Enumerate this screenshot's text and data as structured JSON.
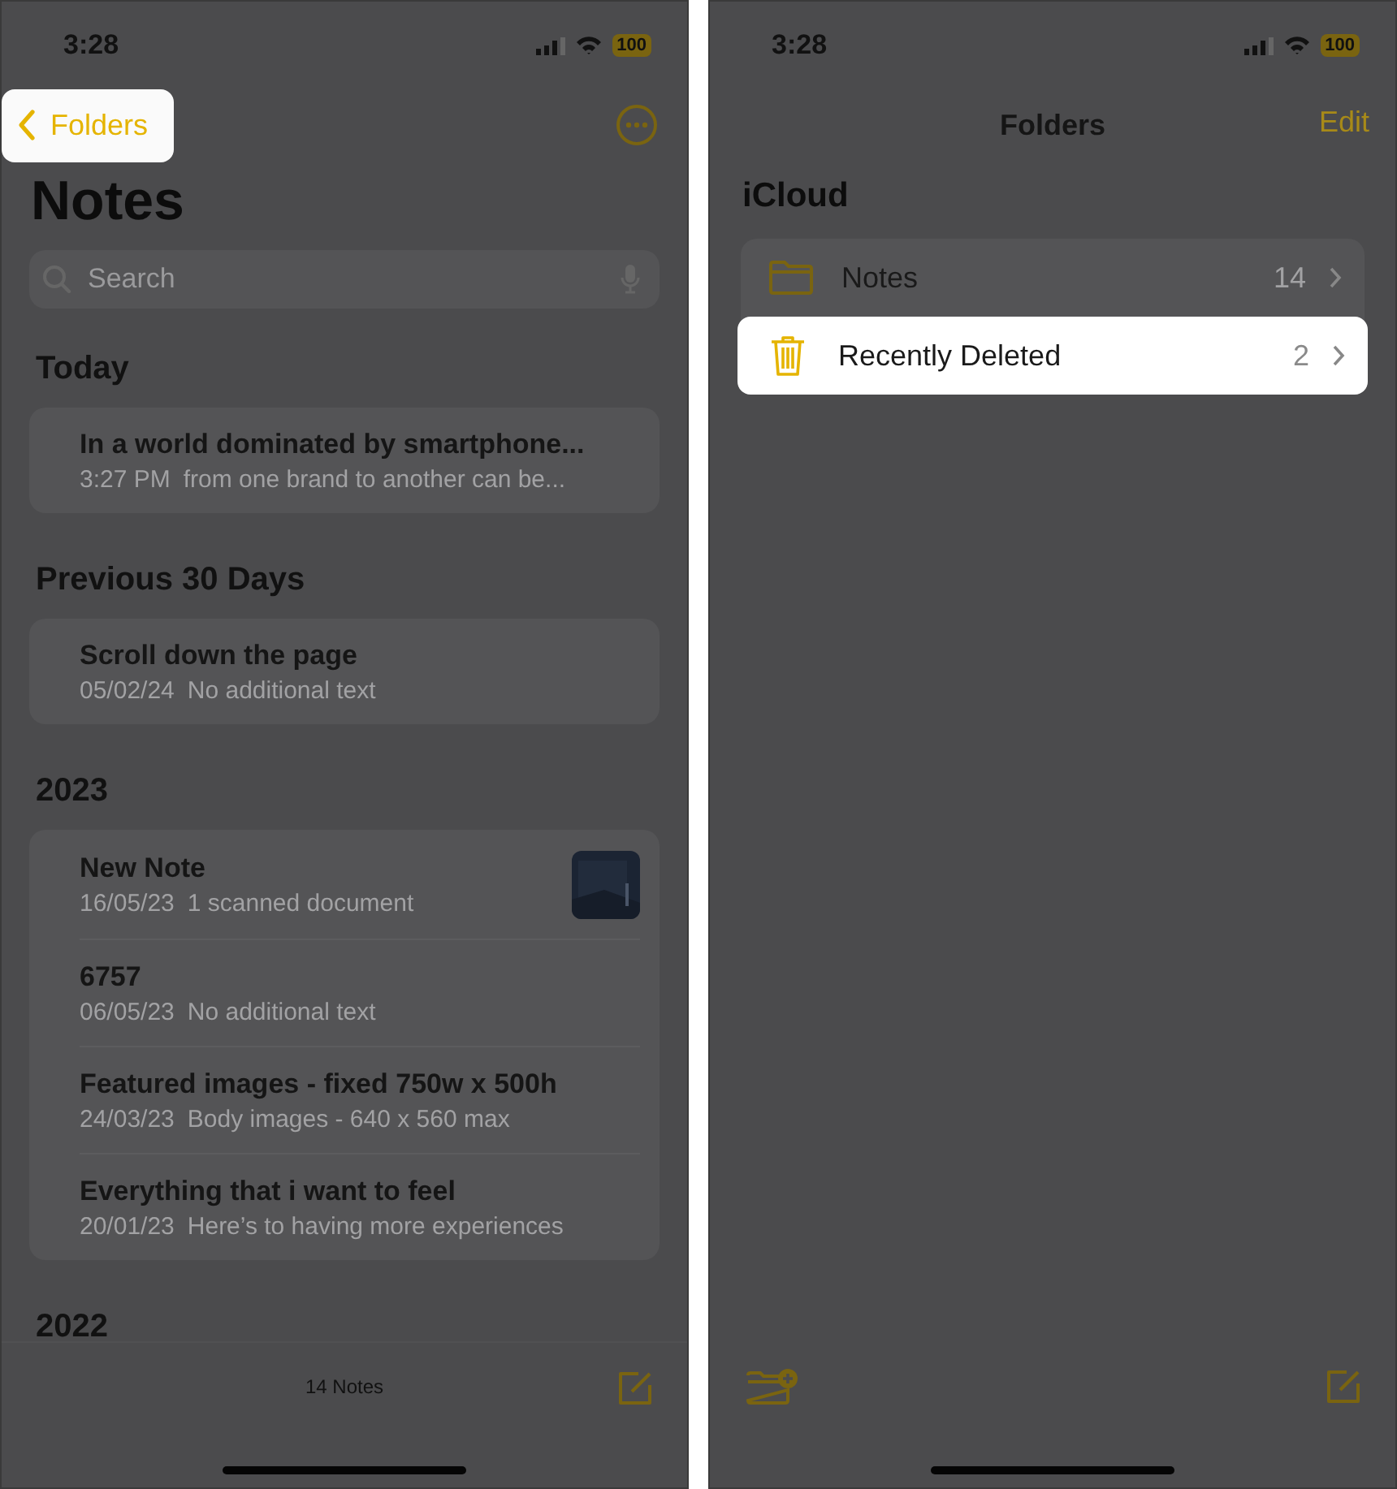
{
  "left_screen": {
    "status_bar": {
      "time": "3:28",
      "battery": "100"
    },
    "nav": {
      "back": {
        "label": "Folders",
        "highlighted": true
      }
    },
    "title": "Notes",
    "search": {
      "placeholder": "Search"
    },
    "sections": [
      {
        "heading": "Today",
        "notes": [
          {
            "title": "In a world dominated by smartphone...",
            "date": "3:27 PM",
            "preview": "from one brand to another can be..."
          }
        ]
      },
      {
        "heading": "Previous 30 Days",
        "notes": [
          {
            "title": "Scroll down the page",
            "date": "05/02/24",
            "preview": "No additional text"
          }
        ]
      },
      {
        "heading": "2023",
        "notes": [
          {
            "title": "New Note",
            "date": "16/05/23",
            "preview": "1 scanned document"
          },
          {
            "title": "6757",
            "date": "06/05/23",
            "preview": "No additional text"
          },
          {
            "title": "Featured images - fixed 750w x 500h",
            "date": "24/03/23",
            "preview": "Body images - 640 x 560 max"
          },
          {
            "title": "Everything that i want to feel",
            "date": "20/01/23",
            "preview": "Here’s to having more experiences"
          }
        ]
      },
      {
        "heading": "2022"
      }
    ],
    "toolbar": {
      "count": "14 Notes"
    }
  },
  "right_screen": {
    "status_bar": {
      "time": "3:28",
      "battery": "100"
    },
    "nav": {
      "title": "Folders",
      "edit": "Edit"
    },
    "account": "iCloud",
    "folders": [
      {
        "kind": "folder",
        "name": "Notes",
        "count": "14",
        "highlighted": false
      },
      {
        "kind": "trash",
        "name": "Recently Deleted",
        "count": "2",
        "highlighted": true
      }
    ]
  }
}
